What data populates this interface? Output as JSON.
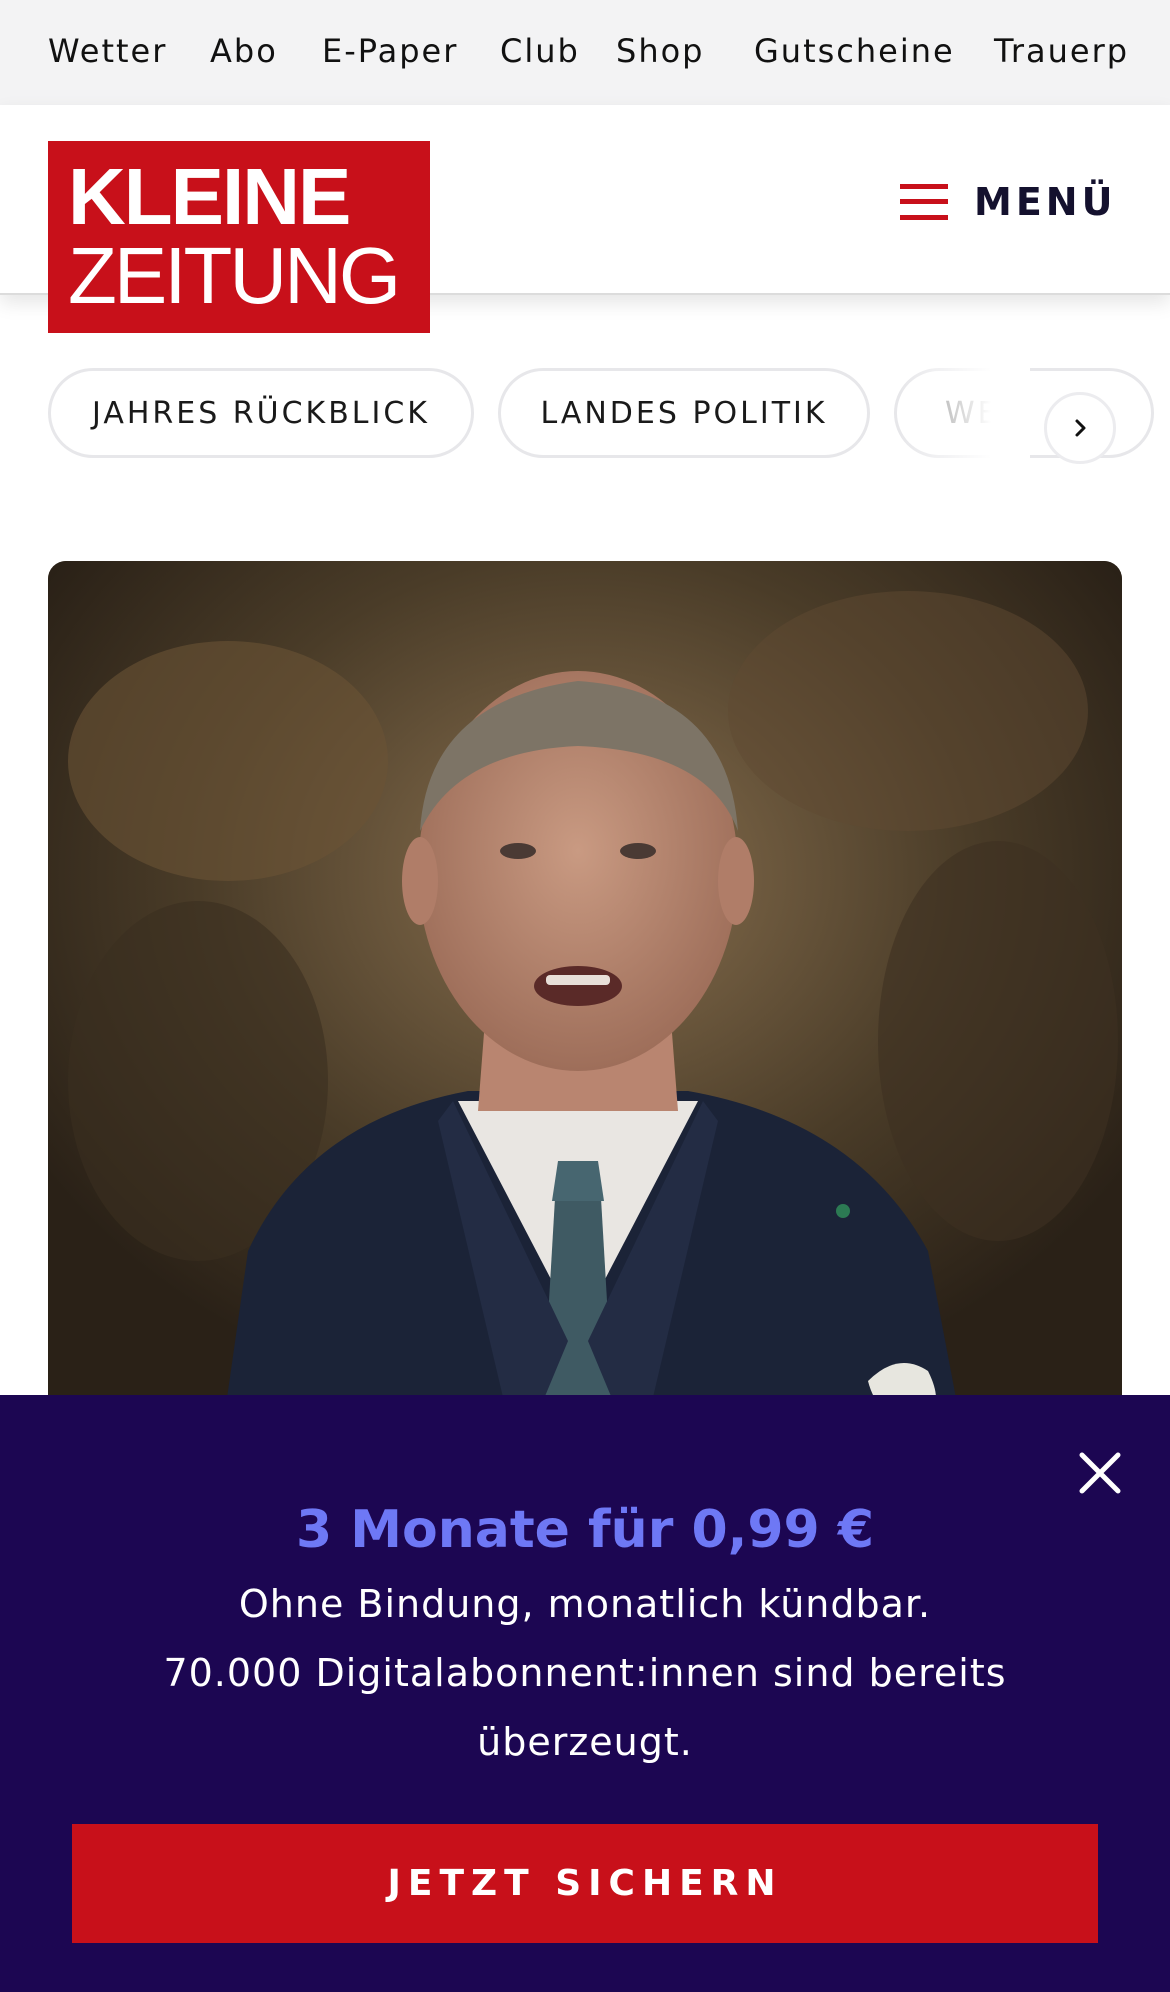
{
  "topbar": {
    "links": [
      "Wetter",
      "Abo",
      "E-Paper",
      "Club",
      "Shop",
      "Gutscheine",
      "Trauerp"
    ]
  },
  "header": {
    "logo_line1": "KLEINE",
    "logo_line2": "ZEITUNG",
    "menu_label": "MENÜ"
  },
  "categories": {
    "chips": [
      "JAHRES RÜCKBLICK",
      "LANDES POLITIK",
      "WE"
    ],
    "next_icon": "chevron-right-icon"
  },
  "hero": {
    "image": "man-in-suit-speaking-photo"
  },
  "promo": {
    "headline": "3 Monate für 0,99 €",
    "line1": "Ohne Bindung, monatlich kündbar.",
    "line2": "70.000 Digitalabonnent:innen sind bereits überzeugt.",
    "cta": "JETZT SICHERN",
    "close_icon": "close-icon"
  },
  "colors": {
    "brand_red": "#c8101a",
    "promo_bg": "#1c0652",
    "promo_accent": "#6e78f5"
  }
}
